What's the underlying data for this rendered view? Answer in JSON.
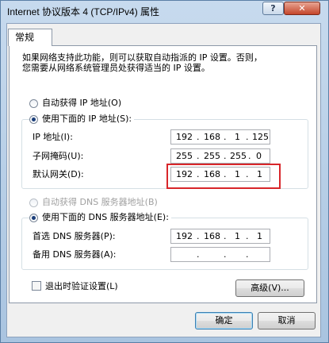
{
  "window": {
    "title": "Internet 协议版本 4 (TCP/IPv4) 属性",
    "help_glyph": "?",
    "close_glyph": "✕"
  },
  "tabs": [
    "常规"
  ],
  "description": [
    "如果网络支持此功能，则可以获取自动指派的 IP 设置。否则，",
    "您需要从网络系统管理员处获得适当的 IP 设置。"
  ],
  "ip_section": {
    "auto_option": "自动获得 IP 地址(O)",
    "manual_option": "使用下面的 IP 地址(S):",
    "selected": "manual",
    "fields": [
      {
        "label": "IP 地址(I):",
        "octets": [
          "192",
          "168",
          "1",
          "125"
        ]
      },
      {
        "label": "子网掩码(U):",
        "octets": [
          "255",
          "255",
          "255",
          "0"
        ]
      },
      {
        "label": "默认网关(D):",
        "octets": [
          "192",
          "168",
          "1",
          "1"
        ]
      }
    ]
  },
  "dns_section": {
    "auto_option": "自动获得 DNS 服务器地址(B)",
    "manual_option": "使用下面的 DNS 服务器地址(E):",
    "selected": "manual",
    "fields": [
      {
        "label": "首选 DNS 服务器(P):",
        "octets": [
          "192",
          "168",
          "1",
          "1"
        ]
      },
      {
        "label": "备用 DNS 服务器(A):",
        "octets": [
          "",
          "",
          "",
          ""
        ]
      }
    ]
  },
  "validate_on_exit": {
    "label": "退出时验证设置(L)",
    "checked": false
  },
  "buttons": {
    "advanced": "高级(V)...",
    "ok": "确定",
    "cancel": "取消"
  },
  "highlight_color": "#d8262a"
}
